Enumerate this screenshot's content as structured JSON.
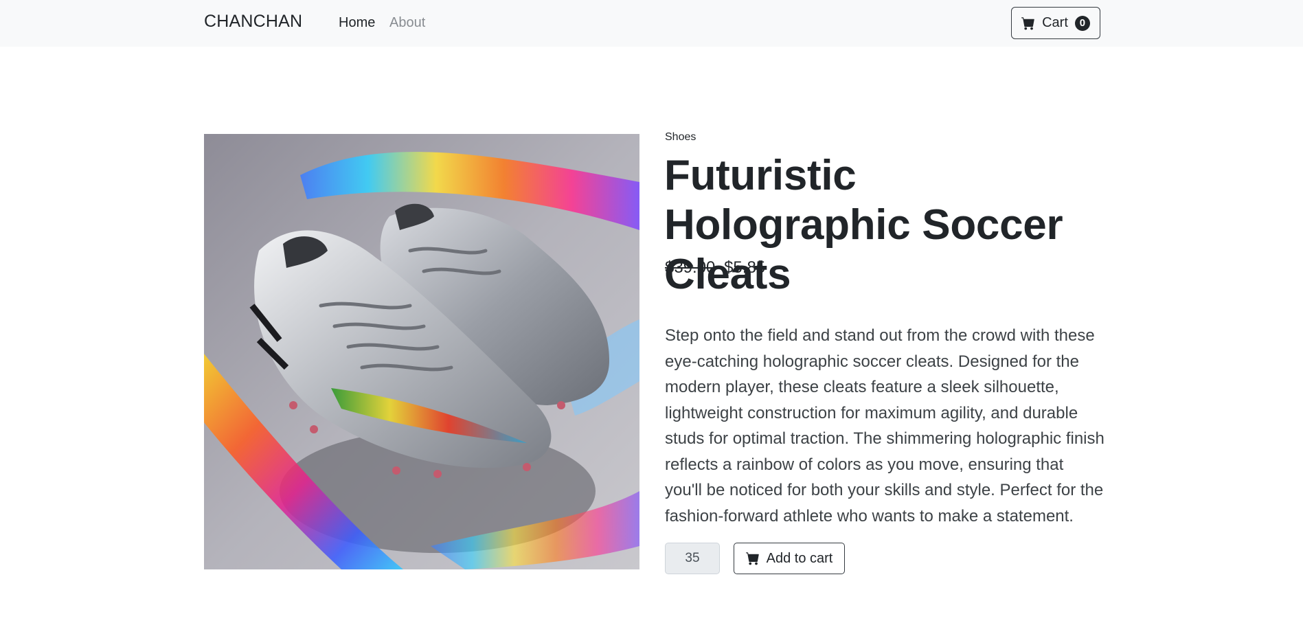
{
  "navbar": {
    "brand": "CHANCHAN",
    "links": [
      {
        "label": "Home",
        "active": true
      },
      {
        "label": "About",
        "active": false
      }
    ],
    "cart": {
      "label": "Cart",
      "count": "0",
      "icon": "cart-icon"
    }
  },
  "product": {
    "category": "Shoes",
    "title": "Futuristic Holographic Soccer Cleats",
    "old_price": "$39.00",
    "price": "$5.85",
    "description": "Step onto the field and stand out from the crowd with these eye-catching holographic soccer cleats. Designed for the modern player, these cleats feature a sleek silhouette, lightweight construction for maximum agility, and durable studs for optimal traction. The shimmering holographic finish reflects a rainbow of colors as you move, ensuring that you'll be noticed for both your skills and style. Perfect for the fashion-forward athlete who wants to make a statement.",
    "image_alt": "Futuristic Holographic Soccer Cleats",
    "quantity": "35",
    "add_to_cart_label": "Add to cart",
    "add_to_cart_icon": "cart-icon"
  },
  "colors": {
    "navbar_bg": "#f8f9fa",
    "text": "#212529",
    "muted_link": "#888c91",
    "input_bg": "#e9ecef"
  }
}
